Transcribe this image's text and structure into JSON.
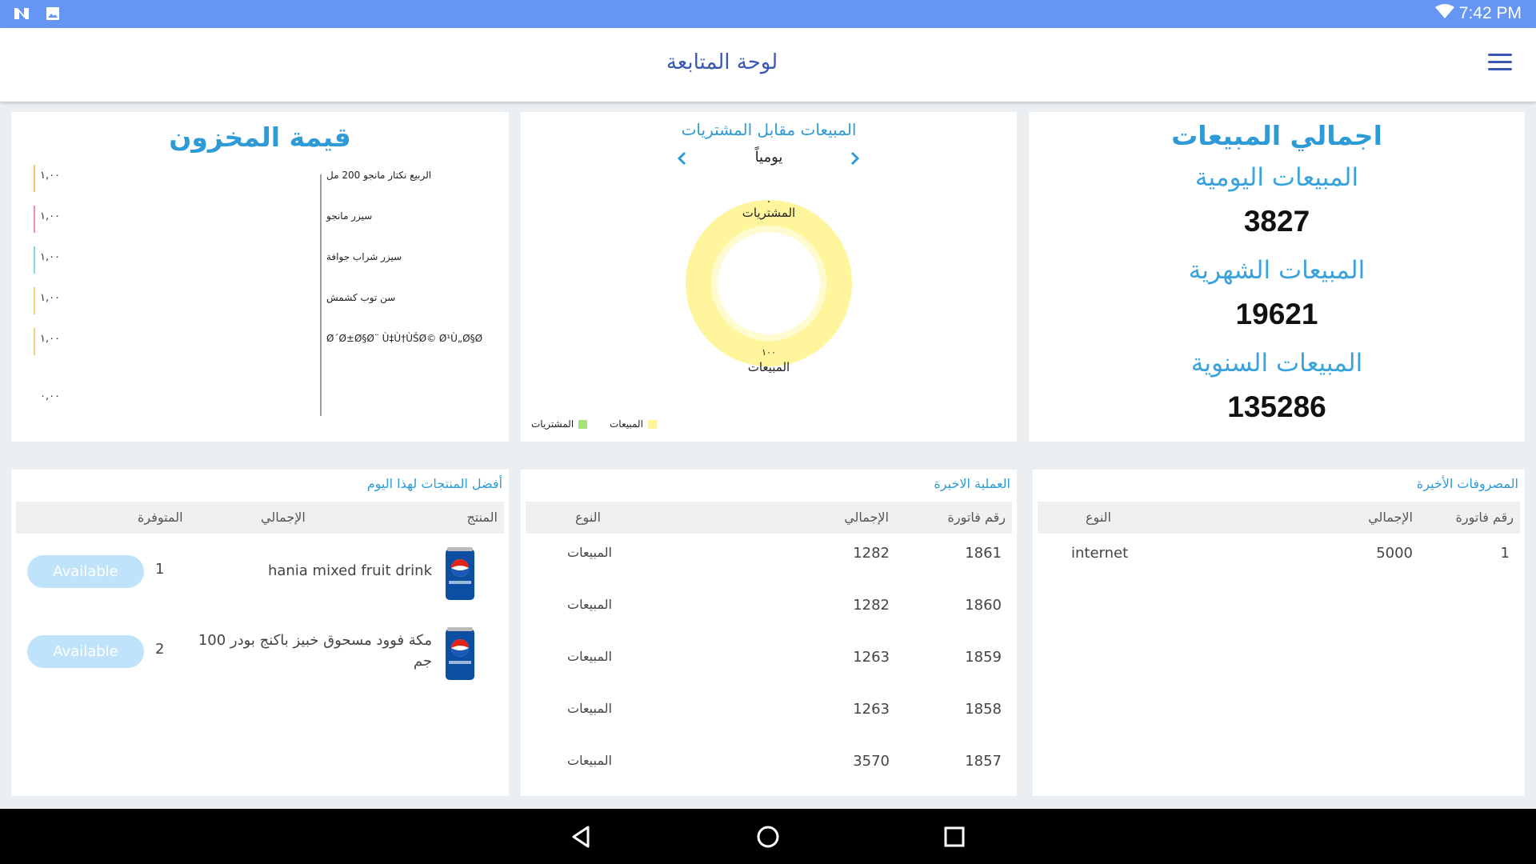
{
  "status_bar": {
    "time": "7:42 PM",
    "left_icons": [
      "n-app-icon",
      "image-icon"
    ],
    "right_icons": [
      "wifi-icon"
    ]
  },
  "app_bar": {
    "title": "لوحة المتابعة",
    "menu_icon": "hamburger-menu-icon",
    "accent_color": "#3c58b5"
  },
  "stock_value": {
    "title": "قيمة المخزون",
    "items": [
      {
        "label": "الربيع نكتار مانجو  200 مل",
        "value": "١,٠٠",
        "color": "#f5c96b"
      },
      {
        "label": "سيزر مانجو",
        "value": "١,٠٠",
        "color": "#f28bb6"
      },
      {
        "label": "سيزر شراب جوافة",
        "value": "١,٠٠",
        "color": "#86d4e8"
      },
      {
        "label": "سن توب كشمش",
        "value": "١,٠٠",
        "color": "#f4d36a"
      },
      {
        "label": "Ø´Ø±Ø§Ø¨ Ù‡Ù†ÙŠØ© Ø¹Ù„Ø§Ø",
        "value": "١,٠٠",
        "color": "#f1cf78"
      }
    ],
    "axis_min_label": "٠,٠٠"
  },
  "sales_vs_purchases": {
    "title": "المبيعات مقابل المشتريات",
    "period": "يومياً",
    "prev_icon": "chevron-left-icon",
    "next_icon": "chevron-right-icon",
    "purchases_value": "٠",
    "purchases_label": "المشتريات",
    "sales_value": "١٠٠",
    "sales_label": "المبيعات",
    "legend": [
      {
        "name": "المبيعات",
        "color": "#fff59d"
      },
      {
        "name": "المشتريات",
        "color": "#a5e27a"
      }
    ]
  },
  "chart_data": {
    "type": "pie",
    "title": "المبيعات مقابل المشتريات",
    "categories": [
      "المبيعات",
      "المشتريات"
    ],
    "values": [
      100,
      0
    ],
    "colors": [
      "#fff59d",
      "#a5e27a"
    ],
    "legend": "bottom-left"
  },
  "sales_totals": {
    "title": "اجمالي المبيعات",
    "daily_label": "المبيعات اليومية",
    "daily_value": "3827",
    "monthly_label": "المبيعات الشهرية",
    "monthly_value": "19621",
    "yearly_label": "المبيعات السنوية",
    "yearly_value": "135286"
  },
  "top_products": {
    "title": "أفضل المنتجات لهذا اليوم",
    "headers": {
      "product": "المنتج",
      "total": "الإجمالي",
      "available": "المتوفرة"
    },
    "rows": [
      {
        "name": "hania mixed fruit drink",
        "qty": "1",
        "status": "Available",
        "image_icon": "pepsi-can-icon"
      },
      {
        "name": "مكة فوود مسحوق خبيز باكنج بودر 100 جم",
        "qty": "2",
        "status": "Available",
        "image_icon": "pepsi-can-icon"
      }
    ]
  },
  "recent_operations": {
    "title": "العملية الاخيرة",
    "headers": {
      "invoice": "رقم فاتورة",
      "total": "الإجمالي",
      "type": "النوع"
    },
    "rows": [
      {
        "invoice": "1861",
        "total": "1282",
        "type": "المبيعات"
      },
      {
        "invoice": "1860",
        "total": "1282",
        "type": "المبيعات"
      },
      {
        "invoice": "1859",
        "total": "1263",
        "type": "المبيعات"
      },
      {
        "invoice": "1858",
        "total": "1263",
        "type": "المبيعات"
      },
      {
        "invoice": "1857",
        "total": "3570",
        "type": "المبيعات"
      }
    ]
  },
  "recent_expenses": {
    "title": "المصروفات الأخيرة",
    "headers": {
      "invoice": "رقم فاتورة",
      "total": "الإجمالي",
      "type": "النوع"
    },
    "rows": [
      {
        "invoice": "1",
        "total": "5000",
        "type": "internet"
      }
    ]
  },
  "nav_bar": {
    "buttons": [
      "back-icon",
      "home-icon",
      "recents-icon"
    ]
  }
}
